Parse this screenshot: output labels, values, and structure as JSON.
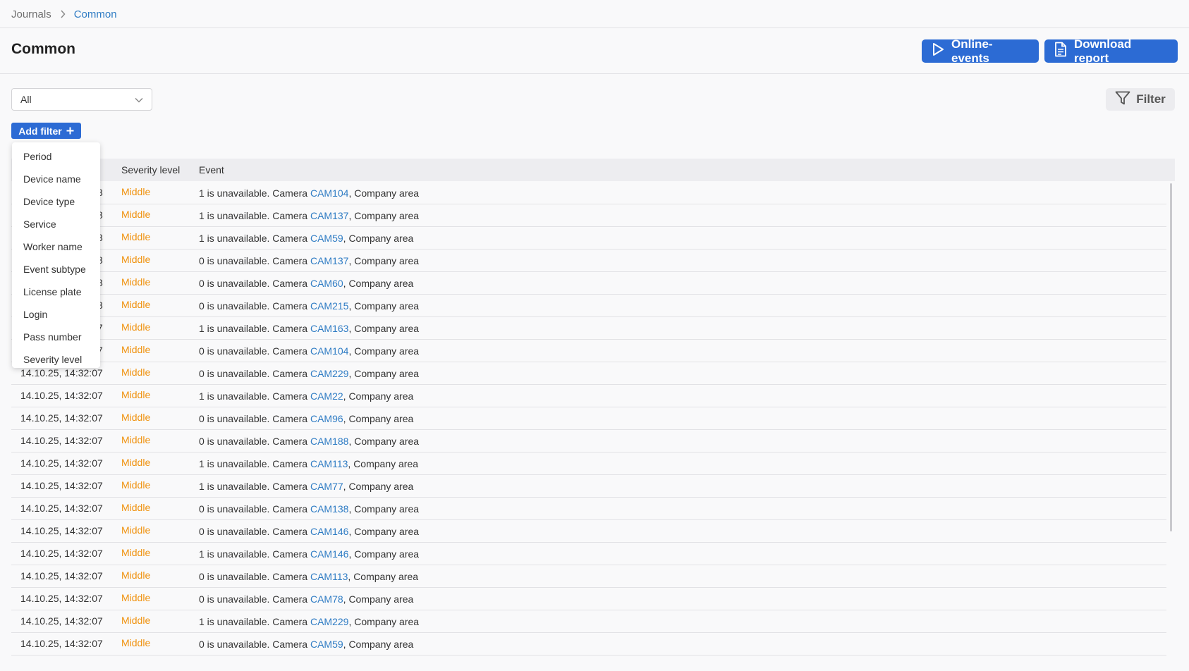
{
  "breadcrumb": {
    "root": "Journals",
    "current": "Common"
  },
  "header": {
    "title": "Common",
    "online_events_label": "Online-events",
    "download_report_label": "Download report"
  },
  "toolbar": {
    "select_value": "All",
    "filter_label": "Filter",
    "add_filter_label": "Add filter"
  },
  "filter_menu": {
    "options": [
      "Period",
      "Device name",
      "Device type",
      "Service",
      "Worker name",
      "Event subtype",
      "License plate",
      "Login",
      "Pass number",
      "Severity level"
    ]
  },
  "table": {
    "columns": {
      "severity": "Severity level",
      "event": "Event"
    },
    "rows": [
      {
        "time": "14.10.25, 14:32:08",
        "severity": "Middle",
        "prefix": "1 is unavailable. Camera ",
        "camera": "CAM104",
        "suffix": ", Company area"
      },
      {
        "time": "14.10.25, 14:32:08",
        "severity": "Middle",
        "prefix": "1 is unavailable. Camera ",
        "camera": "CAM137",
        "suffix": ", Company area"
      },
      {
        "time": "14.10.25, 14:32:08",
        "severity": "Middle",
        "prefix": "1 is unavailable. Camera ",
        "camera": "CAM59",
        "suffix": ", Company area"
      },
      {
        "time": "14.10.25, 14:32:08",
        "severity": "Middle",
        "prefix": "0 is unavailable. Camera ",
        "camera": "CAM137",
        "suffix": ", Company area"
      },
      {
        "time": "14.10.25, 14:32:08",
        "severity": "Middle",
        "prefix": "0 is unavailable. Camera ",
        "camera": "CAM60",
        "suffix": ", Company area"
      },
      {
        "time": "14.10.25, 14:32:08",
        "severity": "Middle",
        "prefix": "0 is unavailable. Camera ",
        "camera": "CAM215",
        "suffix": ", Company area"
      },
      {
        "time": "14.10.25, 14:32:07",
        "severity": "Middle",
        "prefix": "1 is unavailable. Camera ",
        "camera": "CAM163",
        "suffix": ", Company area"
      },
      {
        "time": "14.10.25, 14:32:07",
        "severity": "Middle",
        "prefix": "0 is unavailable. Camera ",
        "camera": "CAM104",
        "suffix": ", Company area"
      },
      {
        "time": "14.10.25, 14:32:07",
        "severity": "Middle",
        "prefix": "0 is unavailable. Camera ",
        "camera": "CAM229",
        "suffix": ", Company area"
      },
      {
        "time": "14.10.25, 14:32:07",
        "severity": "Middle",
        "prefix": "1 is unavailable. Camera ",
        "camera": "CAM22",
        "suffix": ", Company area"
      },
      {
        "time": "14.10.25, 14:32:07",
        "severity": "Middle",
        "prefix": "0 is unavailable. Camera ",
        "camera": "CAM96",
        "suffix": ", Company area"
      },
      {
        "time": "14.10.25, 14:32:07",
        "severity": "Middle",
        "prefix": "0 is unavailable. Camera ",
        "camera": "CAM188",
        "suffix": ", Company area"
      },
      {
        "time": "14.10.25, 14:32:07",
        "severity": "Middle",
        "prefix": "1 is unavailable. Camera ",
        "camera": "CAM113",
        "suffix": ", Company area"
      },
      {
        "time": "14.10.25, 14:32:07",
        "severity": "Middle",
        "prefix": "1 is unavailable. Camera ",
        "camera": "CAM77",
        "suffix": ", Company area"
      },
      {
        "time": "14.10.25, 14:32:07",
        "severity": "Middle",
        "prefix": "0 is unavailable. Camera ",
        "camera": "CAM138",
        "suffix": ", Company area"
      },
      {
        "time": "14.10.25, 14:32:07",
        "severity": "Middle",
        "prefix": "0 is unavailable. Camera ",
        "camera": "CAM146",
        "suffix": ", Company area"
      },
      {
        "time": "14.10.25, 14:32:07",
        "severity": "Middle",
        "prefix": "1 is unavailable. Camera ",
        "camera": "CAM146",
        "suffix": ", Company area"
      },
      {
        "time": "14.10.25, 14:32:07",
        "severity": "Middle",
        "prefix": "0 is unavailable. Camera ",
        "camera": "CAM113",
        "suffix": ", Company area"
      },
      {
        "time": "14.10.25, 14:32:07",
        "severity": "Middle",
        "prefix": "0 is unavailable. Camera ",
        "camera": "CAM78",
        "suffix": ", Company area"
      },
      {
        "time": "14.10.25, 14:32:07",
        "severity": "Middle",
        "prefix": "1 is unavailable. Camera ",
        "camera": "CAM229",
        "suffix": ", Company area"
      },
      {
        "time": "14.10.25, 14:32:07",
        "severity": "Middle",
        "prefix": "0 is unavailable. Camera ",
        "camera": "CAM59",
        "suffix": ", Company area"
      }
    ]
  },
  "icons": {
    "breadcrumb_separator": "chevron-right-icon",
    "online_events": "play-icon",
    "download_report": "document-icon",
    "select": "chevron-down-icon",
    "filter": "funnel-icon",
    "add_filter": "plus-icon"
  },
  "colors": {
    "primary": "#2c6bd4",
    "link": "#2f7cc4",
    "severity_middle": "#f0920f"
  }
}
